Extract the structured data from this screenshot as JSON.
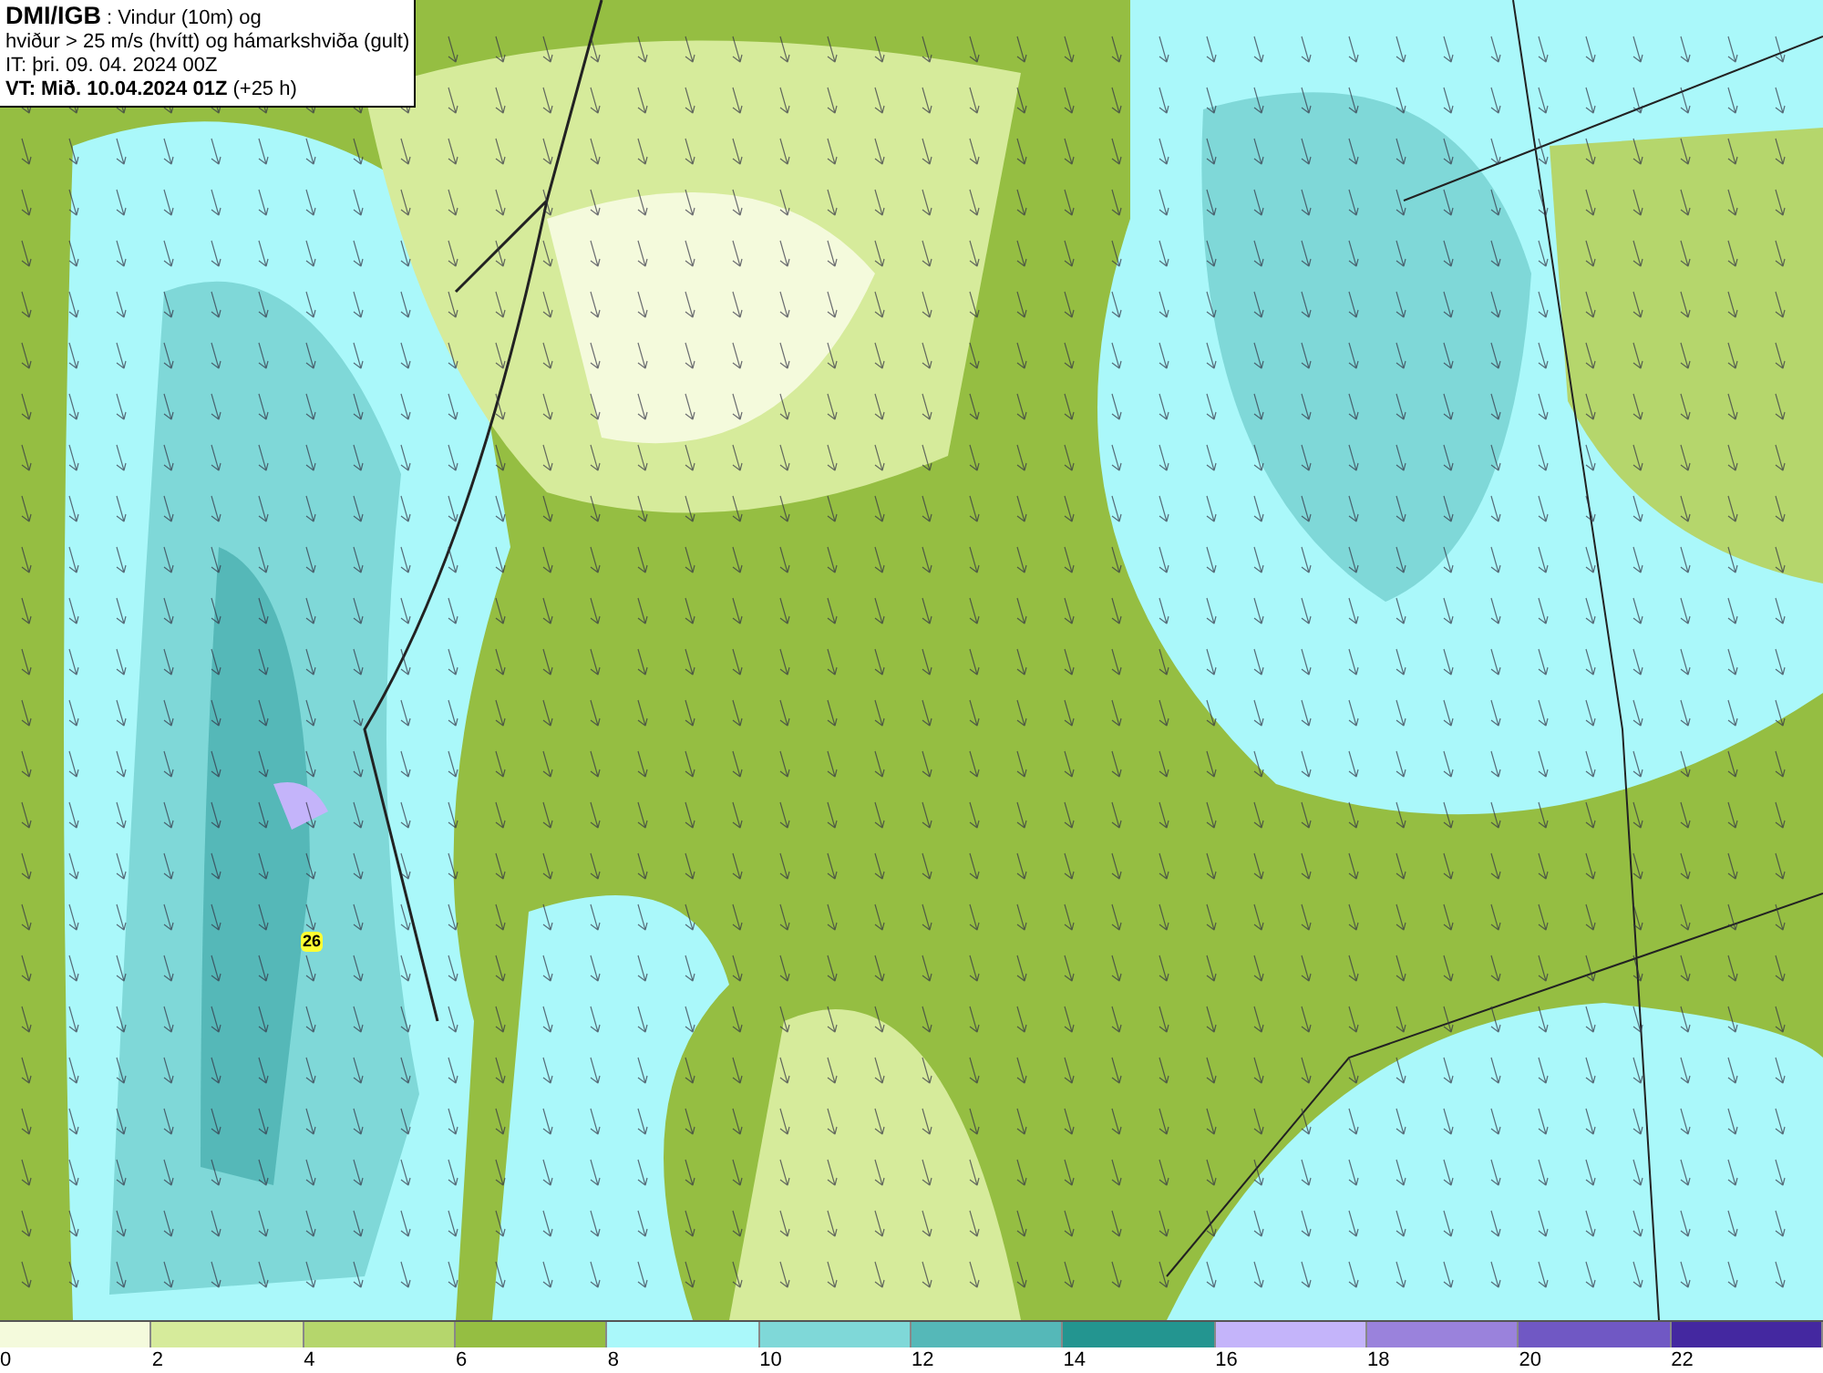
{
  "title_box": {
    "lines": [
      "**DMI/IGB** : Vindur (10m) og",
      "hviður > 25 m/s (hvítt) og hámarkshviða (gult)",
      "IT: þri. 09. 04. 2024 00Z",
      "**VT: Mið. 10.04.2024 01Z** (+25 h)"
    ]
  },
  "map": {
    "gust_label": "26"
  },
  "legend": [
    {
      "label": "0",
      "color": "#f4fadc"
    },
    {
      "label": "2",
      "color": "#d6eb9b"
    },
    {
      "label": "4",
      "color": "#b5d66c"
    },
    {
      "label": "6",
      "color": "#95be42"
    },
    {
      "label": "8",
      "color": "#aaf8fa"
    },
    {
      "label": "10",
      "color": "#7fd8d8"
    },
    {
      "label": "12",
      "color": "#55b8b8"
    },
    {
      "label": "14",
      "color": "#239590"
    },
    {
      "label": "16",
      "color": "#c4b4fa"
    },
    {
      "label": "18",
      "color": "#9a82dc"
    },
    {
      "label": "20",
      "color": "#7058c4"
    },
    {
      "label": "22",
      "color": "#4428a0"
    }
  ]
}
